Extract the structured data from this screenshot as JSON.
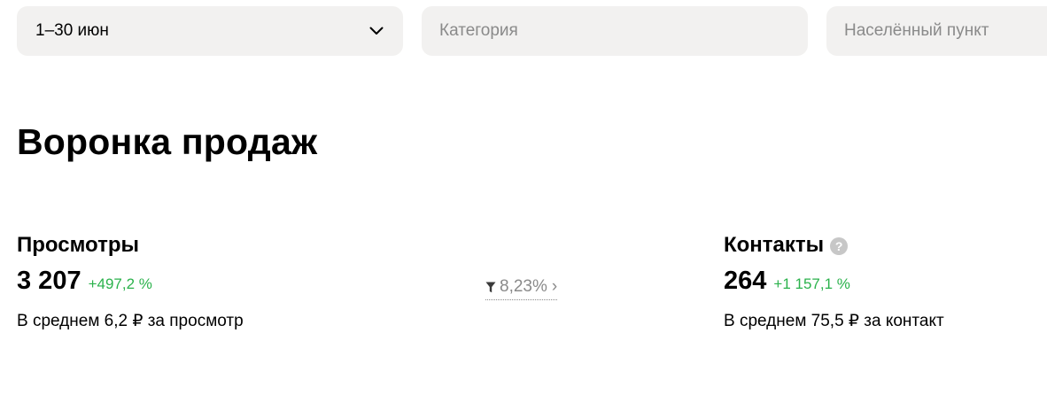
{
  "filters": {
    "period": "1–30 июн",
    "category_placeholder": "Категория",
    "city_placeholder": "Населённый пункт"
  },
  "title": "Воронка продаж",
  "metrics": {
    "views": {
      "title": "Просмотры",
      "value": "3 207",
      "delta": "+497,2 %",
      "avg": "В среднем 6,2 ₽ за просмотр"
    },
    "contacts": {
      "title": "Контакты",
      "help_icon": "?",
      "value": "264",
      "delta": "+1 157,1 %",
      "avg": "В среднем 75,5 ₽ за контакт"
    }
  },
  "conversion": {
    "value": "8,23%",
    "icon": "funnel-icon",
    "arrow": "›"
  },
  "colors": {
    "field_bg": "#f2f1f0",
    "delta_green": "#2bb24c",
    "muted": "#8a8a8a"
  }
}
